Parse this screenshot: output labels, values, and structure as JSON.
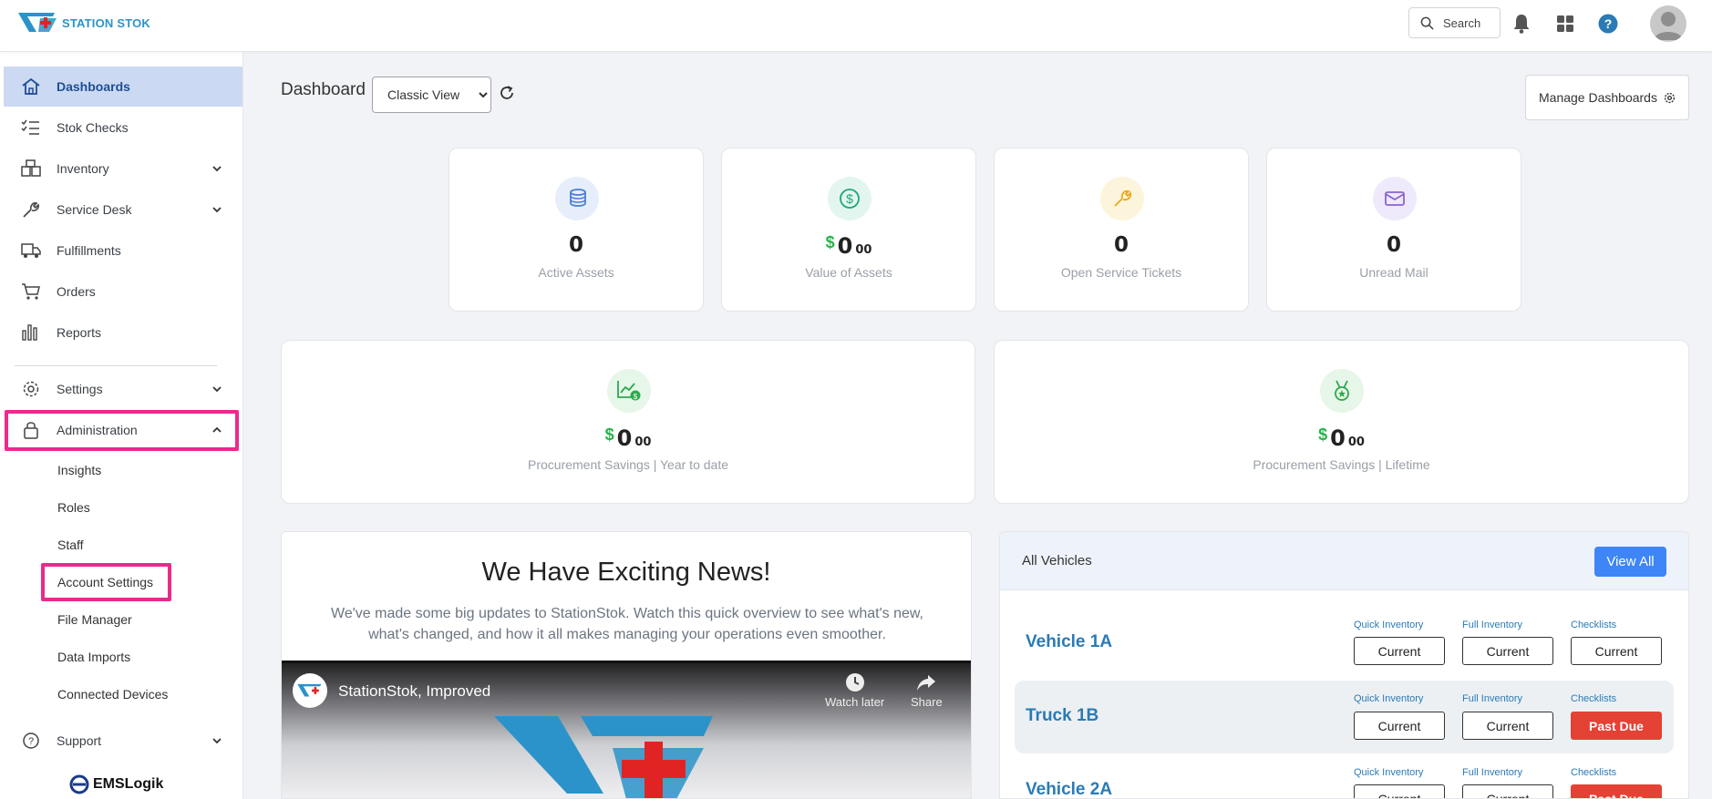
{
  "brand": {
    "name": "STATION STOK",
    "footer_logo": "EMSLogik"
  },
  "colors": {
    "accent": "#3e86f5",
    "active_nav": "#cbdaf2",
    "highlight": "#ea2a8c",
    "past_due": "#e34234",
    "money": "#28b34b"
  },
  "topbar": {
    "search_label": "Search",
    "icons": [
      "search-icon",
      "bell-icon",
      "grid-apps-icon",
      "help-icon",
      "avatar"
    ]
  },
  "sidebar": {
    "items": [
      {
        "label": "Dashboards",
        "icon": "home-icon"
      },
      {
        "label": "Stok Checks",
        "icon": "checklist-icon"
      },
      {
        "label": "Inventory",
        "icon": "boxes-icon"
      },
      {
        "label": "Service Desk",
        "icon": "wrench-icon"
      },
      {
        "label": "Fulfillments",
        "icon": "truck-icon"
      },
      {
        "label": "Orders",
        "icon": "cart-icon"
      },
      {
        "label": "Reports",
        "icon": "bar-chart-icon"
      },
      {
        "label": "Settings",
        "icon": "gear-icon"
      },
      {
        "label": "Administration",
        "icon": "lock-icon"
      },
      {
        "label": "Support",
        "icon": "question-icon"
      }
    ],
    "admin_sub": [
      "Insights",
      "Roles",
      "Staff",
      "Account Settings",
      "File Manager",
      "Data Imports",
      "Connected Devices"
    ]
  },
  "main": {
    "title": "Dashboard",
    "view_selected": "Classic View",
    "manage_label": "Manage Dashboards",
    "stats": [
      {
        "value": "0",
        "label": "Active Assets"
      },
      {
        "dollar": "$",
        "value": "0",
        "cents": "00",
        "label": "Value of Assets"
      },
      {
        "value": "0",
        "label": "Open Service Tickets"
      },
      {
        "value": "0",
        "label": "Unread Mail"
      }
    ],
    "savings": [
      {
        "dollar": "$",
        "value": "0",
        "cents": "00",
        "label": "Procurement Savings | Year to date"
      },
      {
        "dollar": "$",
        "value": "0",
        "cents": "00",
        "label": "Procurement Savings | Lifetime"
      }
    ],
    "news": {
      "title": "We Have Exciting News!",
      "text": "We've made some big updates to StationStok. Watch this quick overview to see what's new, what's changed, and how it all makes managing your operations even smoother.",
      "video_title": "StationStok, Improved",
      "watch_later": "Watch later",
      "share": "Share"
    },
    "vehicles": {
      "title": "All Vehicles",
      "view_all": "View All",
      "columns": [
        "Quick Inventory",
        "Full Inventory",
        "Checklists"
      ],
      "rows": [
        {
          "name": "Vehicle 1A",
          "status": [
            "Current",
            "Current",
            "Current"
          ]
        },
        {
          "name": "Truck 1B",
          "status": [
            "Current",
            "Current",
            "Past Due"
          ]
        },
        {
          "name": "Vehicle 2A",
          "status": [
            "Current",
            "Current",
            "Past Due"
          ]
        }
      ]
    }
  }
}
